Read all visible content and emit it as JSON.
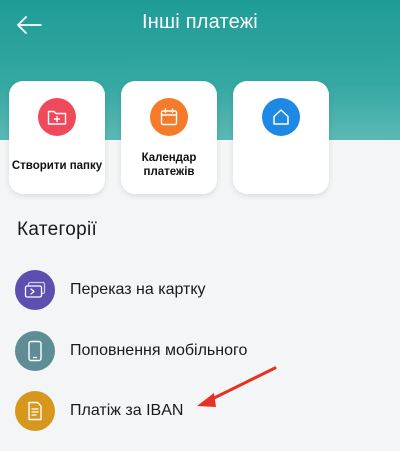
{
  "header": {
    "title": "Інші платежі",
    "back_icon": "arrow-left-icon",
    "bg_color": "#2aa39d"
  },
  "tiles": [
    {
      "label": "Створити папку",
      "icon": "folder-plus-icon",
      "color": "#ef4a5b"
    },
    {
      "label": "Календар платежів",
      "label_line1": "Календар",
      "label_line2": "платежів",
      "icon": "calendar-icon",
      "color": "#f47b2a"
    },
    {
      "label": "",
      "icon": "home-icon",
      "color": "#1e88e5"
    }
  ],
  "categories": {
    "title": "Категорії",
    "items": [
      {
        "label": "Переказ на картку",
        "icon": "card-transfer-icon",
        "color": "#5b4fb0"
      },
      {
        "label": "Поповнення мобільного",
        "icon": "mobile-phone-icon",
        "color": "#5f8d96"
      },
      {
        "label": "Платіж за IBAN",
        "icon": "document-icon",
        "color": "#d6971c"
      }
    ]
  },
  "annotation": {
    "arrow_color": "#e53224"
  }
}
